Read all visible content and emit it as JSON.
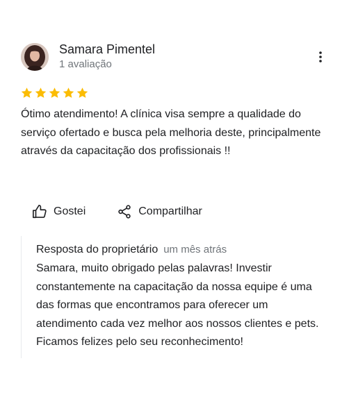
{
  "reviewer": {
    "name": "Samara Pimentel",
    "meta": "1 avaliação"
  },
  "rating": {
    "stars": 5,
    "max": 5,
    "color": "#fbbc04"
  },
  "review": {
    "text": "Ótimo atendimento! A clínica visa sempre a qualidade do serviço ofertado e busca pela melhoria deste, principalmente através da capacitação dos profissionais !!"
  },
  "actions": {
    "like_label": "Gostei",
    "share_label": "Compartilhar"
  },
  "owner_reply": {
    "title": "Resposta do proprietário",
    "time": "um mês atrás",
    "text": "Samara, muito obrigado pelas palavras! Investir constantemente na capacitação da nossa equipe é uma das formas que encontramos para oferecer um atendimento cada vez melhor aos nossos clientes e pets. Ficamos felizes pelo seu reconhecimento!"
  },
  "icons": {
    "menu": "more-vert-icon",
    "like": "thumb-up-icon",
    "share": "share-icon",
    "star": "star-icon"
  }
}
